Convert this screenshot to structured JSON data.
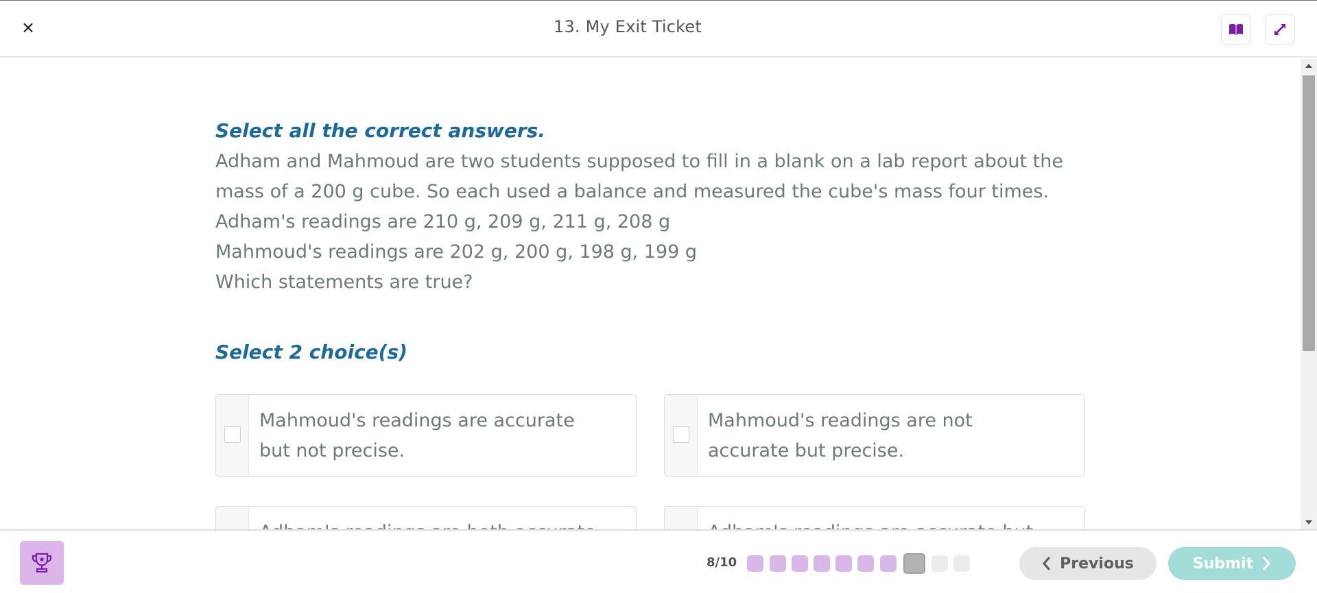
{
  "header": {
    "title": "13. My Exit Ticket",
    "close_label": "×"
  },
  "question": {
    "instruction": "Select all the correct answers.",
    "lines": [
      "Adham and Mahmoud are two students supposed to fill in a blank on a lab report about the mass of a 200 g cube. So each used a balance and measured the cube's mass four times.",
      "Adham's readings are 210 g, 209 g, 211 g, 208 g",
      "Mahmoud's readings are 202 g, 200 g, 198 g, 199 g",
      "Which statements are true?"
    ],
    "select_count_label": "Select 2 choice(s)"
  },
  "choices": [
    {
      "text": "Mahmoud's readings are accurate but not precise.",
      "checked": false
    },
    {
      "text": "Mahmoud's readings are not accurate but precise.",
      "checked": false
    },
    {
      "text": "Adham's readings are both accurate",
      "checked": false
    },
    {
      "text": "Adham's readings are accurate but not",
      "checked": false
    }
  ],
  "footer": {
    "progress_label": "8/10",
    "current_question": 8,
    "total_questions": 10,
    "previous_label": "Previous",
    "submit_label": "Submit"
  },
  "colors": {
    "accent_purple": "#7a1fa2",
    "instruction_blue": "#1c6a9a",
    "answered_dot": "#d9b7e8",
    "submit_teal": "#a3dcd9"
  },
  "icons": {
    "close": "close-icon",
    "book": "book-icon",
    "expand": "expand-icon",
    "trophy": "trophy-icon",
    "prev": "chevron-left-icon",
    "next": "chevron-right-icon"
  }
}
